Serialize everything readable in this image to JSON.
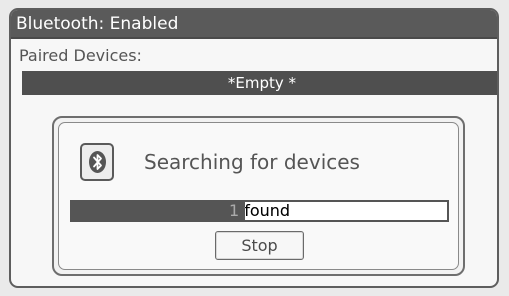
{
  "window": {
    "title": "Bluetooth: Enabled"
  },
  "paired": {
    "label": "Paired Devices:",
    "empty_text": "*Empty *"
  },
  "dialog": {
    "icon": "bluetooth-icon",
    "message": "Searching for devices",
    "progress": {
      "text": "1 found",
      "fill_fraction": 0.46
    },
    "stop_label": "Stop"
  },
  "colors": {
    "titlebar": "#5a5a5a",
    "bar": "#4f4f4f",
    "text": "#555555",
    "background": "#f7f7f7"
  }
}
